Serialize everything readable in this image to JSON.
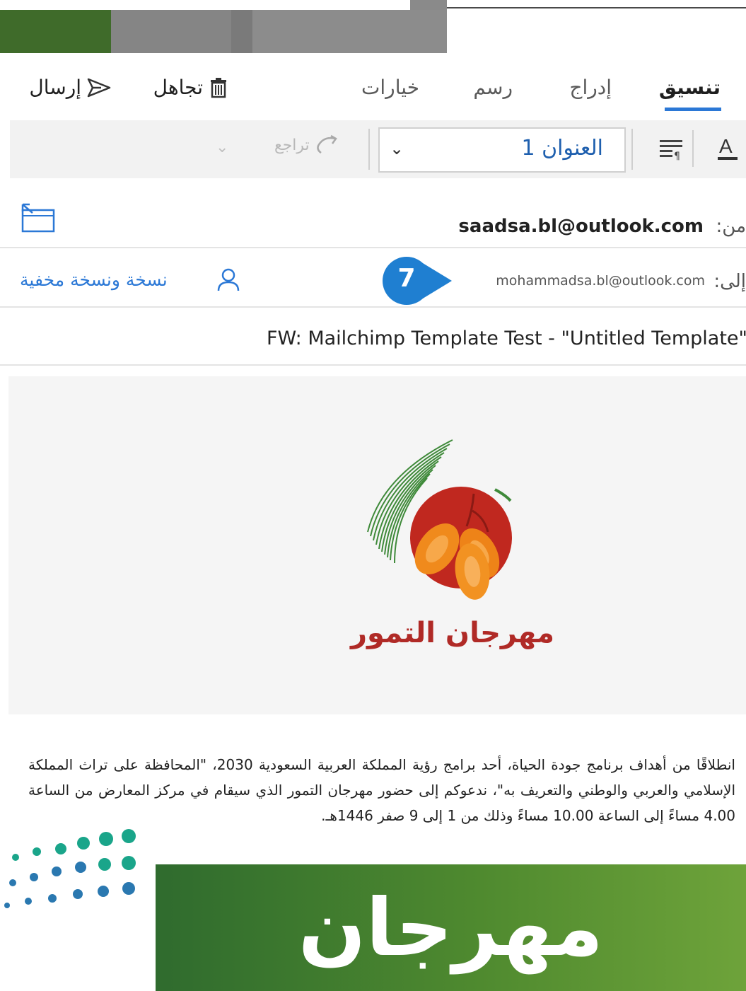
{
  "ribbon": {
    "tabs": [
      {
        "label": "تنسيق",
        "active": true
      },
      {
        "label": "إدراج",
        "active": false
      },
      {
        "label": "رسم",
        "active": false
      },
      {
        "label": "خيارات",
        "active": false
      }
    ],
    "discard_label": "تجاهل",
    "send_label": "إرسال"
  },
  "toolbar": {
    "heading_style": "العنوان 1",
    "redo_label": "تراجع"
  },
  "message": {
    "from_label": "من:",
    "from_value": "saadsa.bl@outlook.com",
    "to_label": "إلى:",
    "to_value": "mohammadsa.bl@outlook.com",
    "cc_bcc_label": "نسخة ونسخة مخفية",
    "subject": "FW: Mailchimp Template Test - \"Untitled Template\""
  },
  "step_badge": "7",
  "email_body": {
    "logo_title": "مهرجان التمور",
    "paragraph": "انطلاقًا من أهداف برنامج جودة الحياة، أحد برامج رؤية المملكة العربية السعودية 2030، \"المحافظة على تراث المملكة الإسلامي والعربي والوطني والتعريف به\"، ندعوكم إلى حضور مهرجان التمور الذي سيقام في مركز المعارض من الساعة 4.00 مساءً إلى الساعة 10.00 مساءً وذلك من 1 إلى 9 صفر 1446هـ.",
    "banner_text": "مهرجان"
  },
  "colors": {
    "accent": "#2b78d6",
    "logo_red": "#b02a26",
    "banner_green": "#3f7a2e",
    "badge_blue": "#1f7fd1"
  }
}
